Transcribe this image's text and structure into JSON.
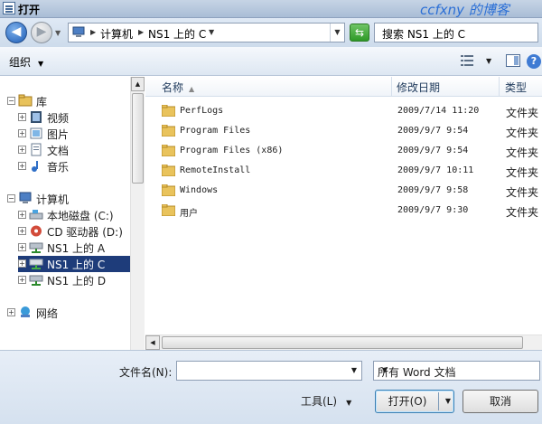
{
  "window": {
    "title": "打开",
    "watermark": "ccfxny 的博客"
  },
  "address": {
    "crumbs": [
      {
        "label": "计算机"
      },
      {
        "label": "NS1 上的 C"
      }
    ],
    "search_placeholder": "搜索 NS1 上的 C"
  },
  "toolbar": {
    "organize": "组织"
  },
  "sidebar": {
    "items": [
      {
        "label": "库",
        "icon": "library-icon",
        "expand": "−",
        "level": 0
      },
      {
        "label": "视频",
        "icon": "video-icon",
        "expand": "+",
        "level": 1
      },
      {
        "label": "图片",
        "icon": "pictures-icon",
        "expand": "+",
        "level": 1
      },
      {
        "label": "文档",
        "icon": "documents-icon",
        "expand": "+",
        "level": 1
      },
      {
        "label": "音乐",
        "icon": "music-icon",
        "expand": "+",
        "level": 1
      },
      {
        "label": "计算机",
        "icon": "computer-icon",
        "expand": "−",
        "level": 0
      },
      {
        "label": "本地磁盘 (C:)",
        "icon": "drive-icon",
        "expand": "+",
        "level": 1
      },
      {
        "label": "CD 驱动器 (D:)",
        "icon": "cd-drive-icon",
        "expand": "+",
        "level": 1
      },
      {
        "label": "NS1 上的 A",
        "icon": "network-drive-icon",
        "expand": "+",
        "level": 1
      },
      {
        "label": "NS1 上的 C",
        "icon": "network-drive-icon",
        "expand": "+",
        "level": 1,
        "selected": true
      },
      {
        "label": "NS1 上的 D",
        "icon": "network-drive-icon",
        "expand": "+",
        "level": 1
      },
      {
        "label": "网络",
        "icon": "network-icon",
        "expand": "+",
        "level": 0
      }
    ]
  },
  "columns": {
    "name": "名称",
    "date": "修改日期",
    "type": "类型"
  },
  "files": [
    {
      "name": "PerfLogs",
      "date": "2009/7/14 11:20",
      "type": "文件夹"
    },
    {
      "name": "Program Files",
      "date": "2009/9/7 9:54",
      "type": "文件夹"
    },
    {
      "name": "Program Files (x86)",
      "date": "2009/9/7 9:54",
      "type": "文件夹"
    },
    {
      "name": "RemoteInstall",
      "date": "2009/9/7 10:11",
      "type": "文件夹"
    },
    {
      "name": "Windows",
      "date": "2009/9/7 9:58",
      "type": "文件夹"
    },
    {
      "name": "用户",
      "date": "2009/9/7 9:30",
      "type": "文件夹"
    }
  ],
  "footer": {
    "filename_label": "文件名(N):",
    "filename_value": "",
    "filter": "所有 Word 文档",
    "tools": "工具(L)",
    "open": "打开(O)",
    "cancel": "取消"
  }
}
